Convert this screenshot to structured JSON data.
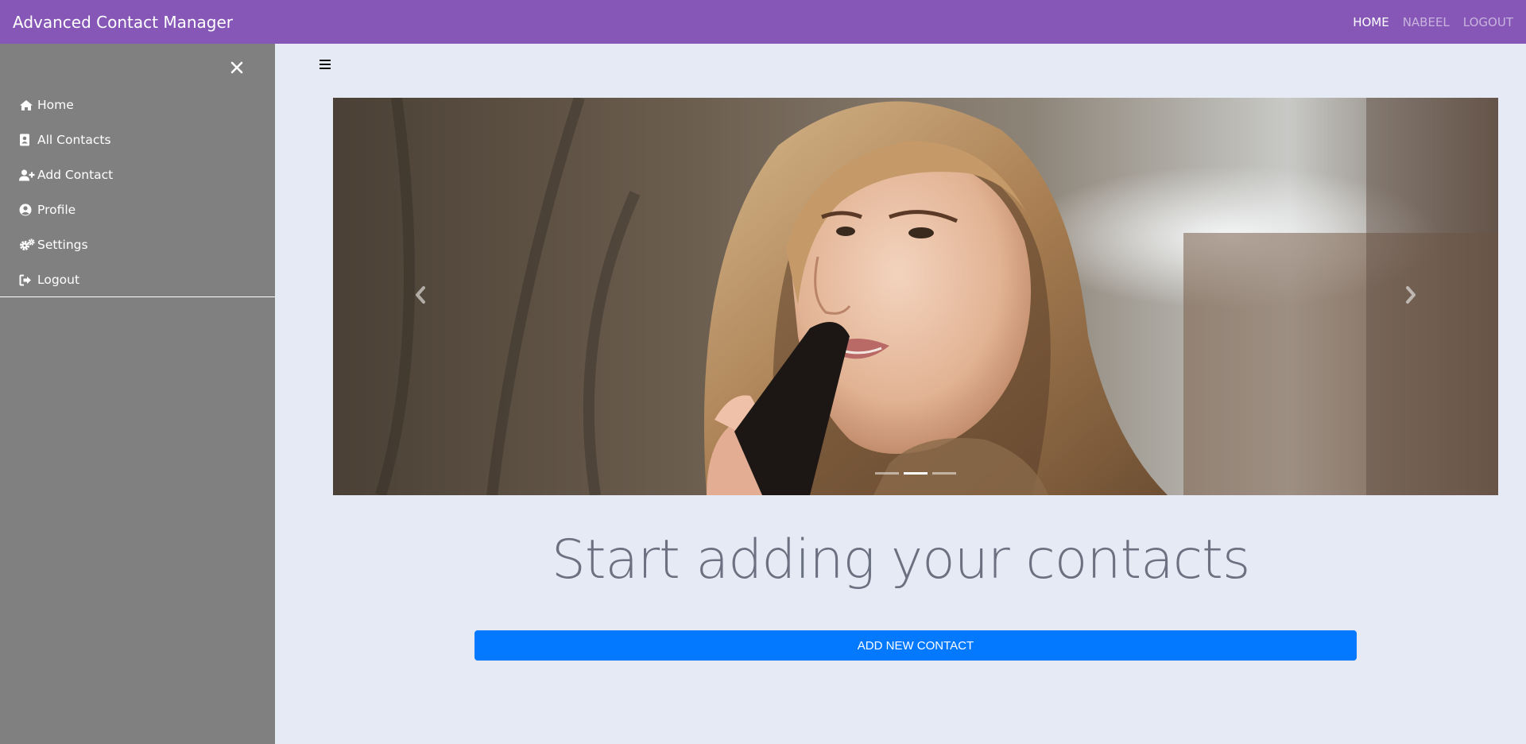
{
  "navbar": {
    "brand": "Advanced Contact Manager",
    "links": [
      {
        "label": "HOME",
        "active": true
      },
      {
        "label": "NABEEL",
        "active": false
      },
      {
        "label": "LOGOUT",
        "active": false
      }
    ]
  },
  "sidebar": {
    "close_icon": "close-icon",
    "items": [
      {
        "label": "Home",
        "icon": "home-icon"
      },
      {
        "label": "All Contacts",
        "icon": "address-book-icon"
      },
      {
        "label": "Add Contact",
        "icon": "user-plus-icon"
      },
      {
        "label": "Profile",
        "icon": "user-circle-icon"
      },
      {
        "label": "Settings",
        "icon": "gears-icon"
      },
      {
        "label": "Logout",
        "icon": "sign-out-icon"
      }
    ]
  },
  "main": {
    "menu_toggle_icon": "hamburger-icon",
    "carousel": {
      "prev_icon": "chevron-left-icon",
      "next_icon": "chevron-right-icon",
      "slide_count": 3,
      "active_slide": 2
    },
    "headline": "Start adding your contacts",
    "add_button": "ADD NEW CONTACT"
  },
  "colors": {
    "navbar": "#8657b6",
    "sidebar": "#808080",
    "page_background": "#e5eaf4",
    "primary_button": "#0279fe",
    "headline_text": "#6b7180"
  }
}
